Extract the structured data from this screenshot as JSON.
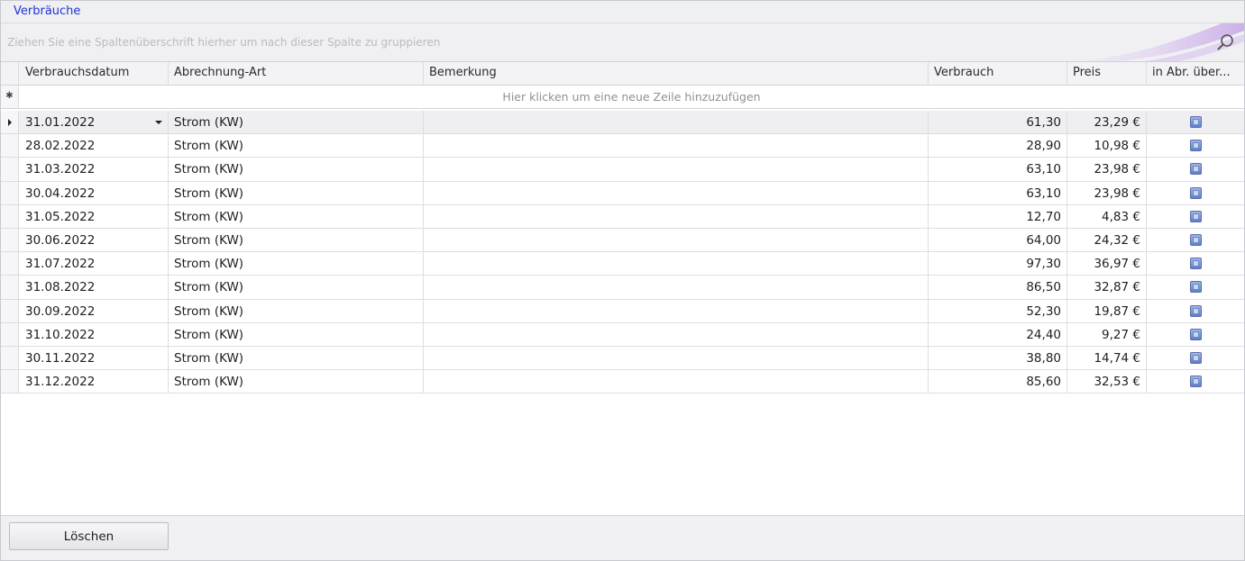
{
  "panel": {
    "title": "Verbräuche",
    "group_hint": "Ziehen Sie eine Spaltenüberschrift hierher um nach dieser Spalte zu gruppieren"
  },
  "grid": {
    "columns": [
      "Verbrauchsdatum",
      "Abrechnung-Art",
      "Bemerkung",
      "Verbrauch",
      "Preis",
      "in Abr. über..."
    ],
    "new_row_text": "Hier klicken um eine neue Zeile hinzuzufügen",
    "new_row_symbol": "✱",
    "rows": [
      {
        "date": "31.01.2022",
        "type": "Strom (KW)",
        "note": "",
        "usage": "61,30",
        "price": "23,29 €",
        "checked": true
      },
      {
        "date": "28.02.2022",
        "type": "Strom (KW)",
        "note": "",
        "usage": "28,90",
        "price": "10,98 €",
        "checked": true
      },
      {
        "date": "31.03.2022",
        "type": "Strom (KW)",
        "note": "",
        "usage": "63,10",
        "price": "23,98 €",
        "checked": true
      },
      {
        "date": "30.04.2022",
        "type": "Strom (KW)",
        "note": "",
        "usage": "63,10",
        "price": "23,98 €",
        "checked": true
      },
      {
        "date": "31.05.2022",
        "type": "Strom (KW)",
        "note": "",
        "usage": "12,70",
        "price": "4,83 €",
        "checked": true
      },
      {
        "date": "30.06.2022",
        "type": "Strom (KW)",
        "note": "",
        "usage": "64,00",
        "price": "24,32 €",
        "checked": true
      },
      {
        "date": "31.07.2022",
        "type": "Strom (KW)",
        "note": "",
        "usage": "97,30",
        "price": "36,97 €",
        "checked": true
      },
      {
        "date": "31.08.2022",
        "type": "Strom (KW)",
        "note": "",
        "usage": "86,50",
        "price": "32,87 €",
        "checked": true
      },
      {
        "date": "30.09.2022",
        "type": "Strom (KW)",
        "note": "",
        "usage": "52,30",
        "price": "19,87 €",
        "checked": true
      },
      {
        "date": "31.10.2022",
        "type": "Strom (KW)",
        "note": "",
        "usage": "24,40",
        "price": "9,27 €",
        "checked": true
      },
      {
        "date": "30.11.2022",
        "type": "Strom (KW)",
        "note": "",
        "usage": "38,80",
        "price": "14,74 €",
        "checked": true
      },
      {
        "date": "31.12.2022",
        "type": "Strom (KW)",
        "note": "",
        "usage": "85,60",
        "price": "32,53 €",
        "checked": true
      }
    ]
  },
  "footer": {
    "delete_label": "Löschen"
  },
  "colors": {
    "title_text": "#1f33d6",
    "checkbox": "#5d7ec9"
  }
}
